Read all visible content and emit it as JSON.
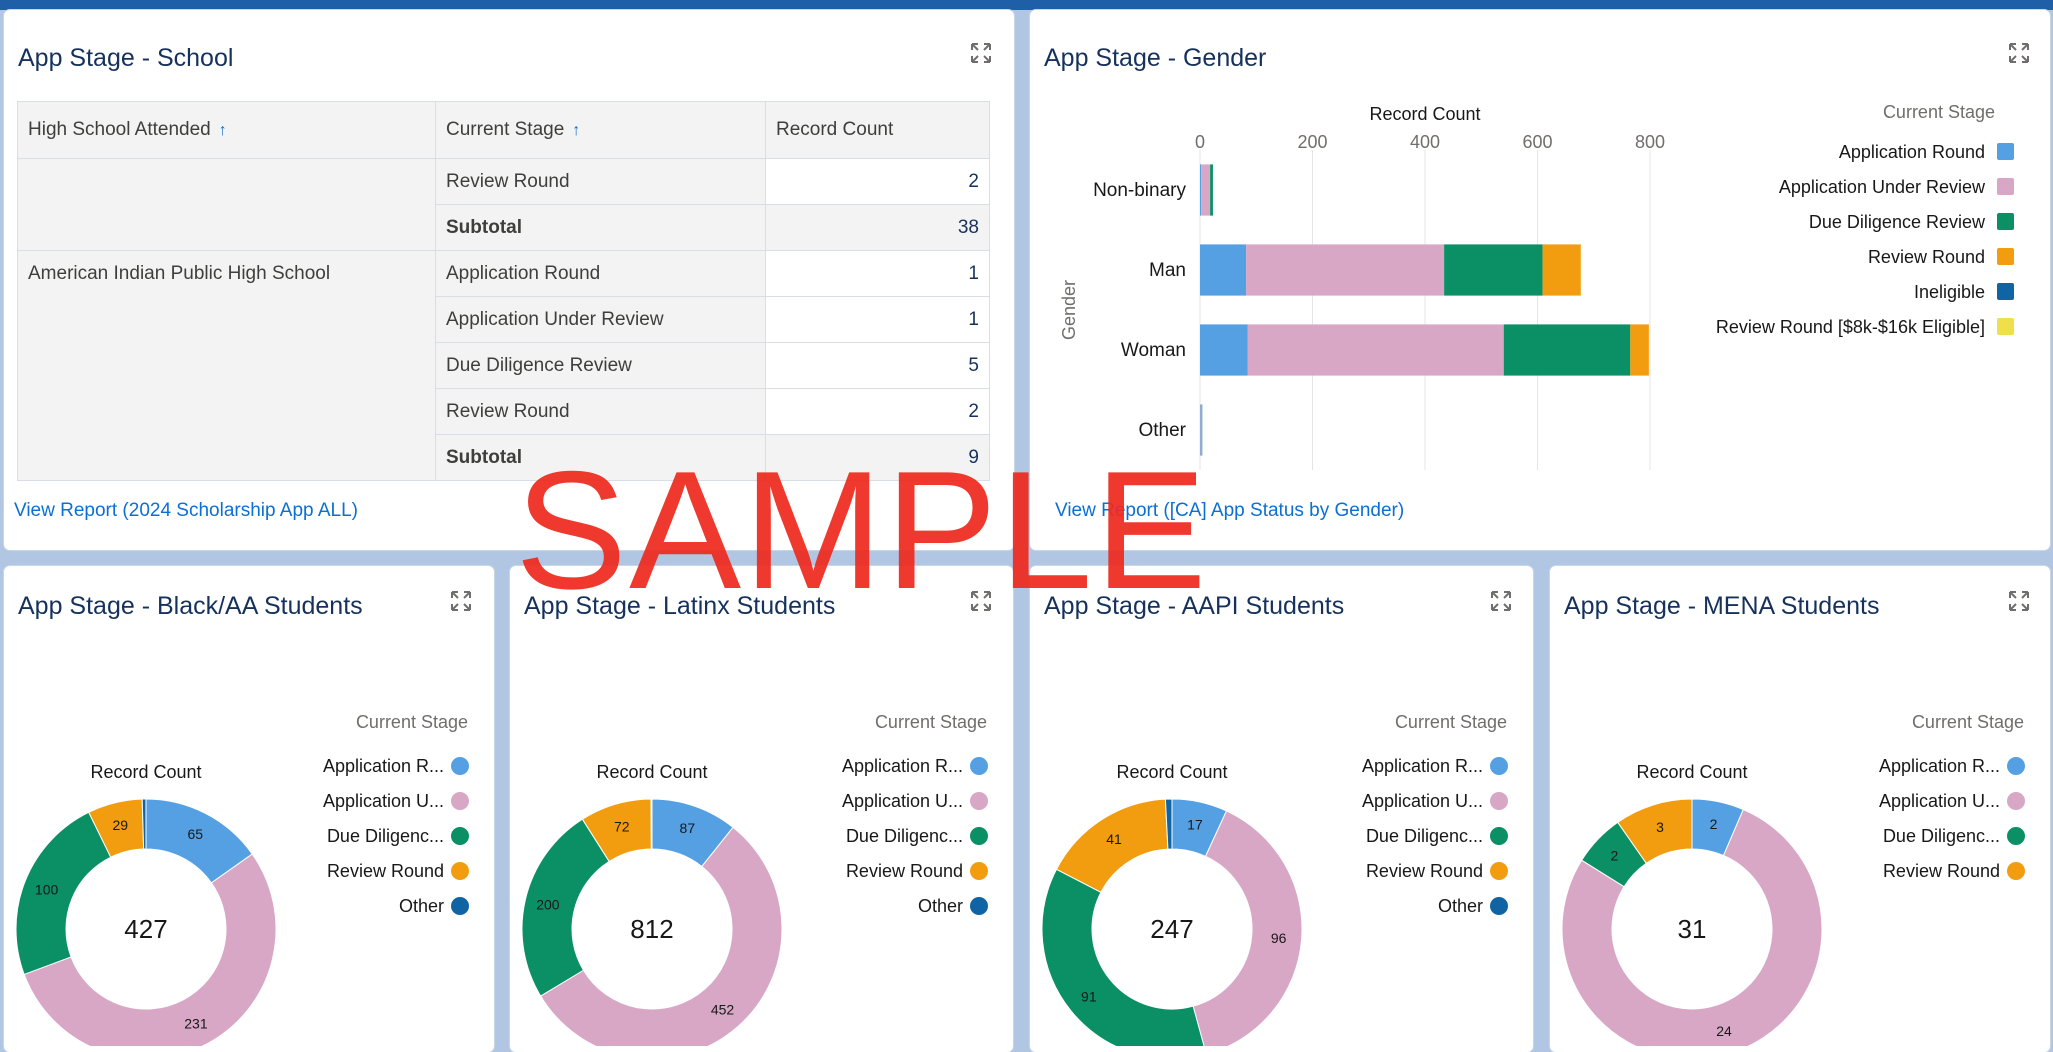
{
  "school_card": {
    "title": "App Stage - School",
    "columns": [
      "High School Attended",
      "Current Stage",
      "Record Count"
    ],
    "rows": [
      {
        "school": "",
        "stage": "Review Round",
        "count": "2",
        "subtotal": false
      },
      {
        "school": "",
        "stage": "Subtotal",
        "count": "38",
        "subtotal": true
      },
      {
        "school": "American Indian Public High School",
        "stage": "Application Round",
        "count": "1",
        "subtotal": false
      },
      {
        "school": "",
        "stage": "Application Under Review",
        "count": "1",
        "subtotal": false
      },
      {
        "school": "",
        "stage": "Due Diligence Review",
        "count": "5",
        "subtotal": false
      },
      {
        "school": "",
        "stage": "Review Round",
        "count": "2",
        "subtotal": false
      },
      {
        "school": "",
        "stage": "Subtotal",
        "count": "9",
        "subtotal": true
      }
    ],
    "link": "View Report (2024 Scholarship App ALL)"
  },
  "gender_card": {
    "title": "App Stage - Gender",
    "link": "View Report ([CA] App Status by Gender)"
  },
  "donut_cards": [
    {
      "title": "App Stage - Black/AA Students"
    },
    {
      "title": "App Stage - Latinx Students"
    },
    {
      "title": "App Stage - AAPI Students"
    },
    {
      "title": "App Stage - MENA Students"
    }
  ],
  "watermark": "SAMPLE",
  "colors": {
    "Application Round": "#54a0e3",
    "Application Under Review": "#d8a7c5",
    "Due Diligence Review": "#0b8f65",
    "Review Round": "#f29d0f",
    "Ineligible": "#1164a3",
    "Review Round [$8k-$16k Eligible]": "#efe04b",
    "Other": "#1164a3"
  },
  "chart_data": [
    {
      "type": "bar",
      "orientation": "horizontal",
      "stacked": true,
      "title": "Record Count",
      "xlabel": "Record Count",
      "ylabel": "Gender",
      "xlim": [
        0,
        800
      ],
      "xticks": [
        0,
        200,
        400,
        600,
        800
      ],
      "categories": [
        "Non-binary",
        "Man",
        "Woman",
        "Other"
      ],
      "legend_title": "Current Stage",
      "legend_position": "right",
      "series": [
        {
          "name": "Application Round",
          "values": [
            2,
            82,
            85,
            1
          ]
        },
        {
          "name": "Application Under Review",
          "values": [
            16,
            352,
            455,
            2
          ]
        },
        {
          "name": "Due Diligence Review",
          "values": [
            5,
            175,
            225,
            1
          ]
        },
        {
          "name": "Review Round",
          "values": [
            0,
            68,
            33,
            0
          ]
        },
        {
          "name": "Ineligible",
          "values": [
            0,
            0,
            0,
            0
          ]
        },
        {
          "name": "Review Round [$8k-$16k Eligible]",
          "values": [
            0,
            0,
            0,
            0
          ]
        }
      ],
      "legend": [
        "Application Round",
        "Application Under Review",
        "Due Diligence Review",
        "Review Round",
        "Ineligible",
        "Review Round [$8k-$16k Eligible]"
      ]
    },
    {
      "type": "pie",
      "donut": true,
      "title": "Record Count",
      "total": "427",
      "legend_title": "Current Stage",
      "legend_position": "right",
      "slices": [
        {
          "name": "Application Round",
          "legend": "Application R...",
          "value": 65
        },
        {
          "name": "Application Under Review",
          "legend": "Application U...",
          "value": 231
        },
        {
          "name": "Due Diligence Review",
          "legend": "Due Diligenc...",
          "value": 100
        },
        {
          "name": "Review Round",
          "legend": "Review Round",
          "value": 29
        },
        {
          "name": "Other",
          "legend": "Other",
          "value": 2
        }
      ]
    },
    {
      "type": "pie",
      "donut": true,
      "title": "Record Count",
      "total": "812",
      "legend_title": "Current Stage",
      "legend_position": "right",
      "slices": [
        {
          "name": "Application Round",
          "legend": "Application R...",
          "value": 87
        },
        {
          "name": "Application Under Review",
          "legend": "Application U...",
          "value": 452
        },
        {
          "name": "Due Diligence Review",
          "legend": "Due Diligenc...",
          "value": 200
        },
        {
          "name": "Review Round",
          "legend": "Review Round",
          "value": 72
        },
        {
          "name": "Other",
          "legend": "Other",
          "value": 1
        }
      ]
    },
    {
      "type": "pie",
      "donut": true,
      "title": "Record Count",
      "total": "247",
      "legend_title": "Current Stage",
      "legend_position": "right",
      "slices": [
        {
          "name": "Application Round",
          "legend": "Application R...",
          "value": 17
        },
        {
          "name": "Application Under Review",
          "legend": "Application U...",
          "value": 96
        },
        {
          "name": "Due Diligence Review",
          "legend": "Due Diligenc...",
          "value": 91
        },
        {
          "name": "Review Round",
          "legend": "Review Round",
          "value": 41
        },
        {
          "name": "Other",
          "legend": "Other",
          "value": 2
        }
      ]
    },
    {
      "type": "pie",
      "donut": true,
      "title": "Record Count",
      "total": "31",
      "legend_title": "Current Stage",
      "legend_position": "right",
      "slices": [
        {
          "name": "Application Round",
          "legend": "Application R...",
          "value": 2
        },
        {
          "name": "Application Under Review",
          "legend": "Application U...",
          "value": 24
        },
        {
          "name": "Due Diligence Review",
          "legend": "Due Diligenc...",
          "value": 2
        },
        {
          "name": "Review Round",
          "legend": "Review Round",
          "value": 3
        }
      ]
    }
  ]
}
